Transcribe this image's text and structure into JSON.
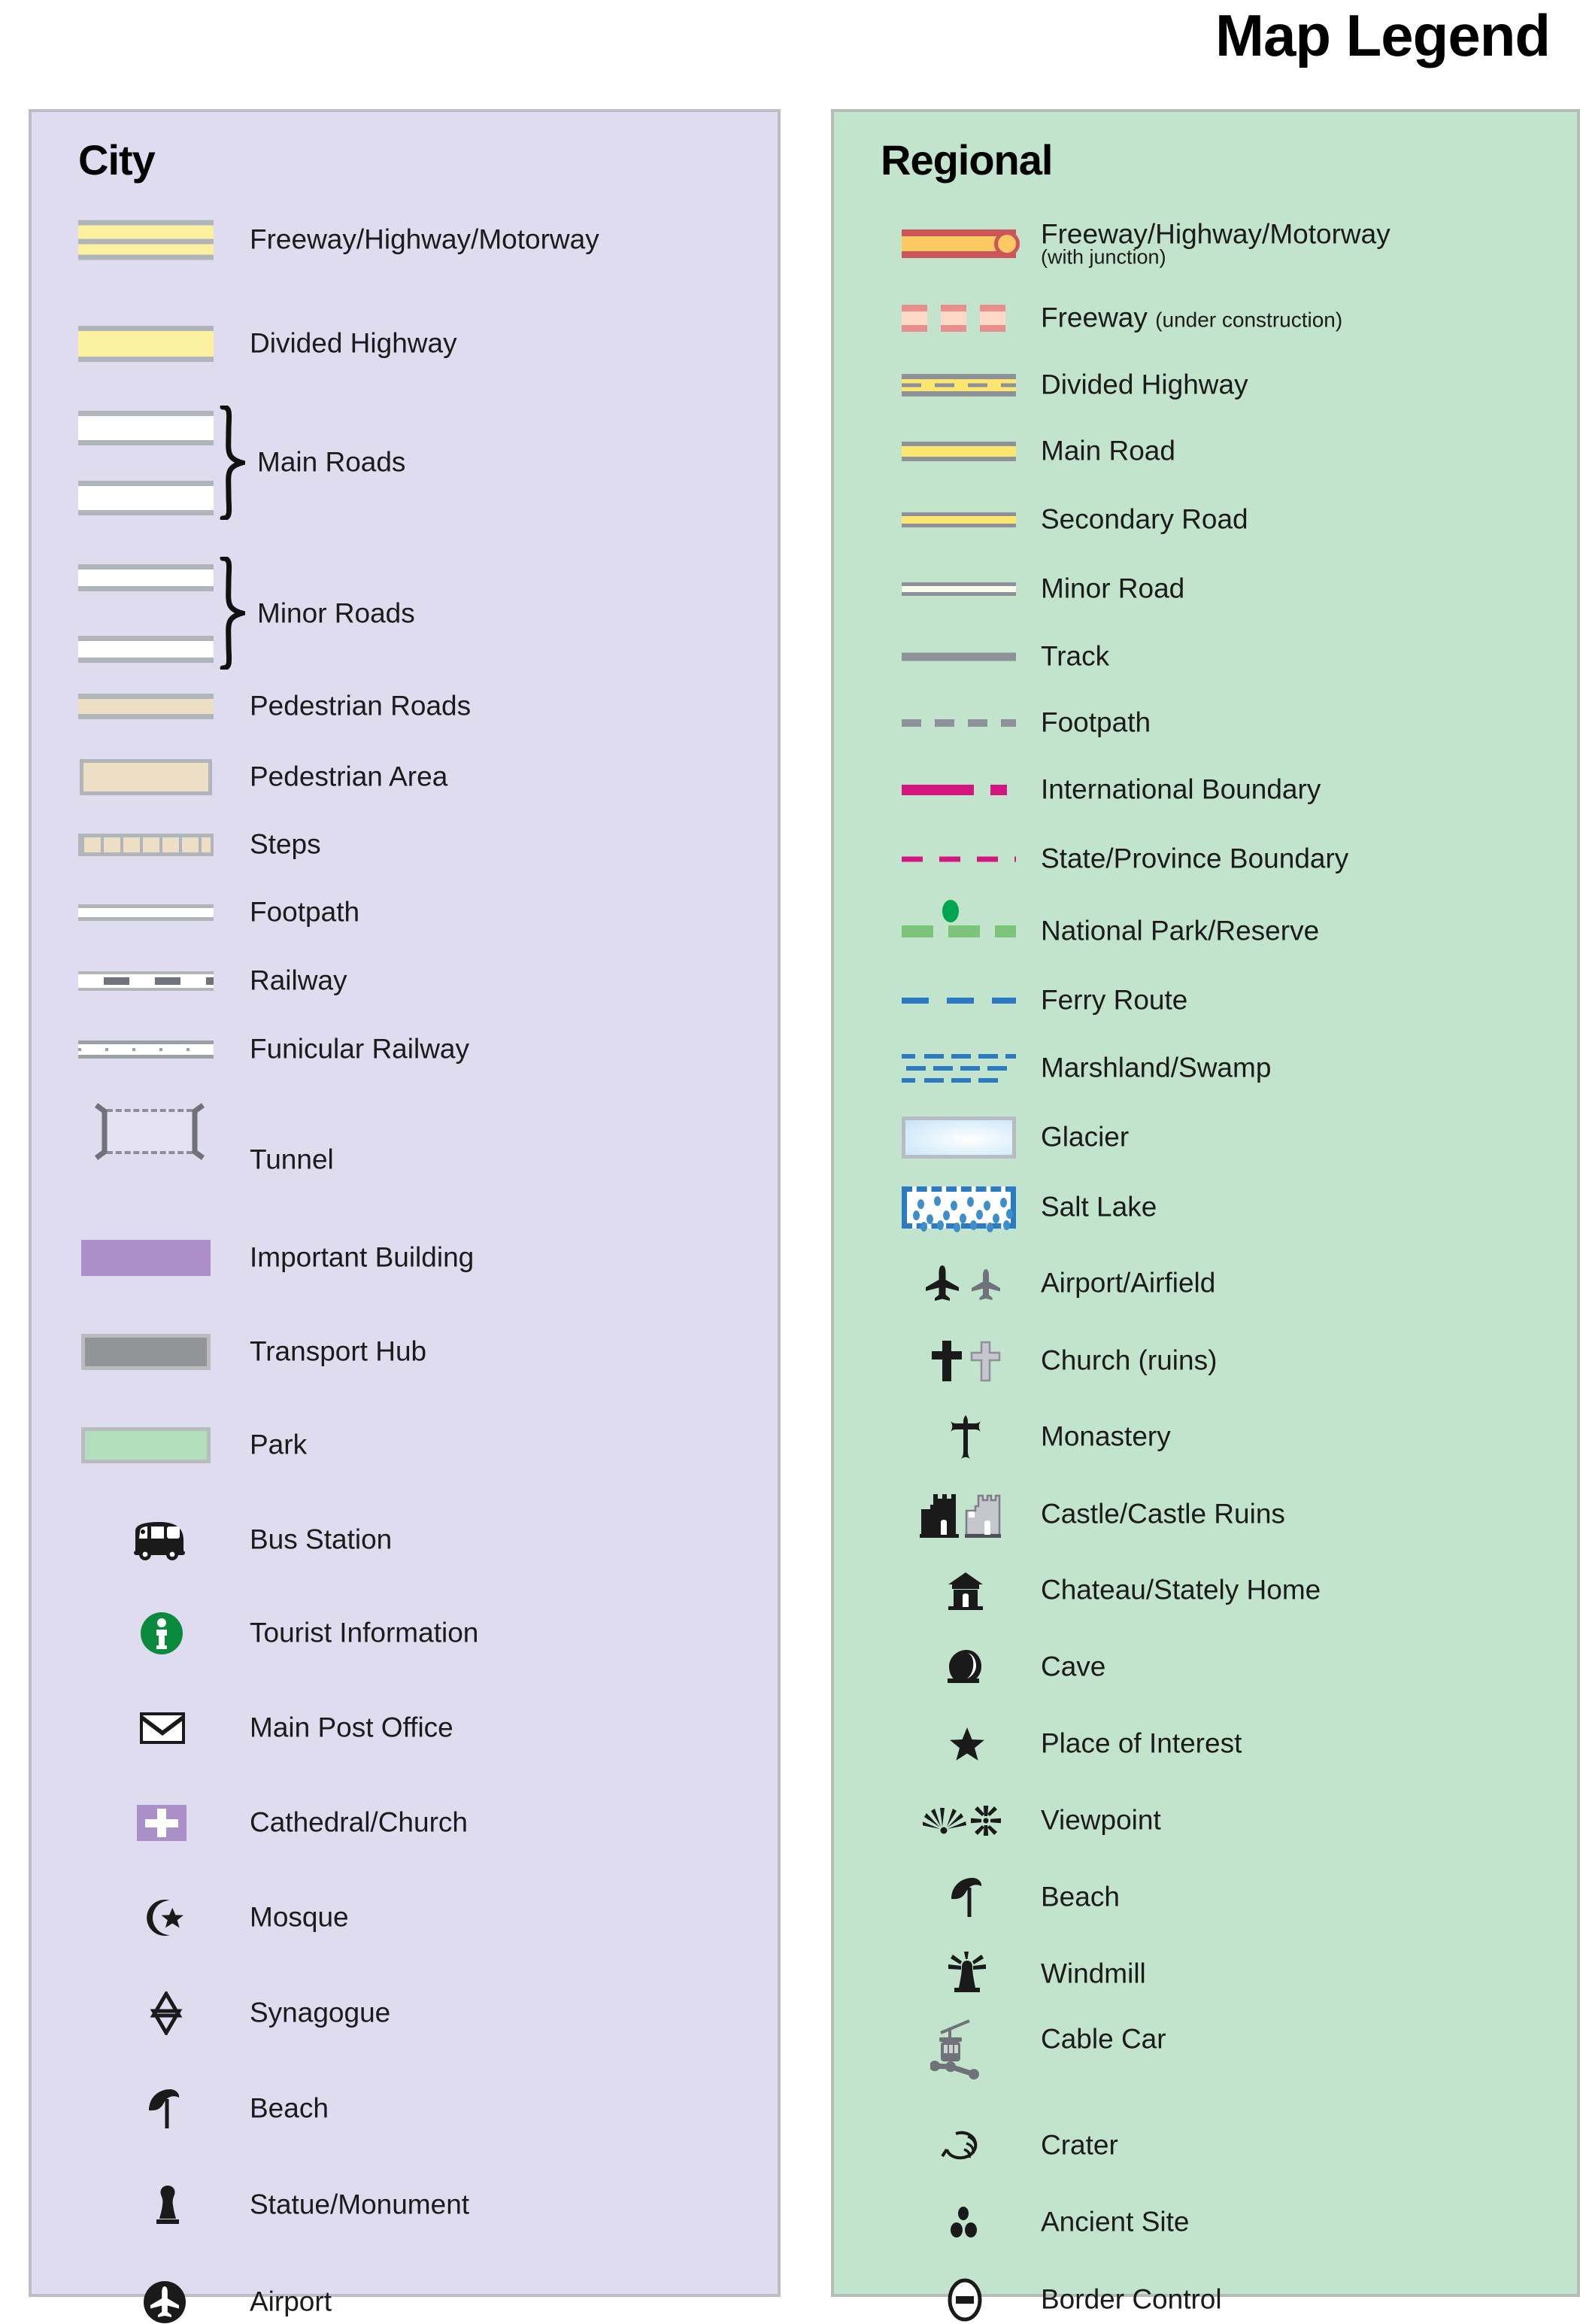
{
  "title": "Map Legend",
  "colors": {
    "city_panel_bg": "#dedcee",
    "regional_panel_bg": "#c3e4cc",
    "panel_border": "#b9b9c2",
    "road_casing_grey": "#b0b5ba",
    "highway_yellow": "#faf0a0",
    "pedestrian_tan": "#ecdfc6",
    "important_building_purple": "#ab8fc8",
    "transport_hub_grey": "#929497",
    "park_green": "#b4dfbe",
    "tourist_info_green": "#0a8a3c",
    "regional_freeway_red": "#cc5558",
    "regional_freeway_orange": "#fcc963",
    "regional_road_yellow": "#fbe76f",
    "regional_casing_grey": "#8d9298",
    "boundary_magenta": "#d4157f",
    "national_park_green": "#7cc47a",
    "national_park_dot": "#00a550",
    "water_blue": "#2a7bc4",
    "glacier_blue": "#d6ecfa",
    "ruins_grey": "#c6c6ce"
  },
  "city": {
    "heading": "City",
    "items": [
      {
        "label": "Freeway/Highway/Motorway",
        "symbol": "dual-carriageway-yellow"
      },
      {
        "label": "Divided Highway",
        "symbol": "single-carriageway-yellow"
      },
      {
        "label": "Main Roads",
        "symbol": "two-white-roads-braced"
      },
      {
        "label": "Minor Roads",
        "symbol": "two-thin-white-roads-braced"
      },
      {
        "label": "Pedestrian Roads",
        "symbol": "tan-road"
      },
      {
        "label": "Pedestrian Area",
        "symbol": "tan-area"
      },
      {
        "label": "Steps",
        "symbol": "steps-pattern"
      },
      {
        "label": "Footpath",
        "symbol": "thin-white-line"
      },
      {
        "label": "Railway",
        "symbol": "railway-dashes"
      },
      {
        "label": "Funicular Railway",
        "symbol": "funicular-ticks"
      },
      {
        "label": "Tunnel",
        "symbol": "tunnel-brackets"
      },
      {
        "label": "Important Building",
        "symbol": "purple-swatch"
      },
      {
        "label": "Transport Hub",
        "symbol": "grey-swatch"
      },
      {
        "label": "Park",
        "symbol": "green-swatch"
      },
      {
        "label": "Bus Station",
        "symbol": "bus-icon"
      },
      {
        "label": "Tourist Information",
        "symbol": "information-circle-icon"
      },
      {
        "label": "Main Post Office",
        "symbol": "envelope-icon"
      },
      {
        "label": "Cathedral/Church",
        "symbol": "cross-on-purple-square-icon"
      },
      {
        "label": "Mosque",
        "symbol": "star-and-crescent-icon"
      },
      {
        "label": "Synagogue",
        "symbol": "star-of-david-icon"
      },
      {
        "label": "Beach",
        "symbol": "beach-umbrella-icon"
      },
      {
        "label": "Statue/Monument",
        "symbol": "statue-icon"
      },
      {
        "label": "Airport",
        "symbol": "airplane-in-circle-icon"
      }
    ]
  },
  "regional": {
    "heading": "Regional",
    "items": [
      {
        "label": "Freeway/Highway/Motorway",
        "sublabel": "(with junction)",
        "sublabel_position": "below",
        "symbol": "freeway-with-junction"
      },
      {
        "label": "Freeway",
        "sublabel": "(under construction)",
        "sublabel_position": "inline",
        "symbol": "freeway-under-construction"
      },
      {
        "label": "Divided Highway",
        "symbol": "divided-highway"
      },
      {
        "label": "Main Road",
        "symbol": "main-road"
      },
      {
        "label": "Secondary Road",
        "symbol": "secondary-road"
      },
      {
        "label": "Minor Road",
        "symbol": "minor-road"
      },
      {
        "label": "Track",
        "symbol": "solid-grey-line"
      },
      {
        "label": "Footpath",
        "symbol": "grey-dashed-line"
      },
      {
        "label": "International Boundary",
        "symbol": "magenta-dash-dot-line"
      },
      {
        "label": "State/Province Boundary",
        "symbol": "magenta-dashed-line"
      },
      {
        "label": "National Park/Reserve",
        "symbol": "green-dashes-with-dot"
      },
      {
        "label": "Ferry Route",
        "symbol": "blue-dashed-line"
      },
      {
        "label": "Marshland/Swamp",
        "symbol": "blue-dash-rows"
      },
      {
        "label": "Glacier",
        "symbol": "pale-blue-swatch"
      },
      {
        "label": "Salt Lake",
        "symbol": "white-stippled-swatch"
      },
      {
        "label": "Airport/Airfield",
        "symbol": "two-airplanes-icon"
      },
      {
        "label": "Church (ruins)",
        "symbol": "two-crosses-icon"
      },
      {
        "label": "Monastery",
        "symbol": "ornate-cross-icon"
      },
      {
        "label": "Castle/Castle Ruins",
        "symbol": "two-castles-icon"
      },
      {
        "label": "Chateau/Stately Home",
        "symbol": "chateau-icon"
      },
      {
        "label": "Cave",
        "symbol": "cave-icon"
      },
      {
        "label": "Place of Interest",
        "symbol": "star-icon"
      },
      {
        "label": "Viewpoint",
        "symbol": "two-viewpoint-bursts-icon"
      },
      {
        "label": "Beach",
        "symbol": "beach-umbrella-icon"
      },
      {
        "label": "Windmill",
        "symbol": "windmill-icon"
      },
      {
        "label": "Cable Car",
        "symbol": "cable-car-icon"
      },
      {
        "label": "Crater",
        "symbol": "crater-icon"
      },
      {
        "label": "Ancient Site",
        "symbol": "three-dots-icon"
      },
      {
        "label": "Border Control",
        "symbol": "minus-in-oval-icon"
      }
    ]
  }
}
